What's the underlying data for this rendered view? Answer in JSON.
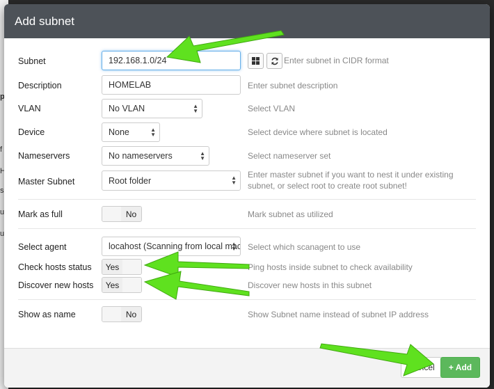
{
  "modal": {
    "title": "Add subnet"
  },
  "fields": {
    "subnet": {
      "label": "Subnet",
      "value": "192.168.1.0/24",
      "hint": "Enter subnet in CIDR format"
    },
    "description": {
      "label": "Description",
      "value": "HOMELAB",
      "hint": "Enter subnet description"
    },
    "vlan": {
      "label": "VLAN",
      "value": "No VLAN",
      "hint": "Select VLAN"
    },
    "device": {
      "label": "Device",
      "value": "None",
      "hint": "Select device where subnet is located"
    },
    "nameservers": {
      "label": "Nameservers",
      "value": "No nameservers",
      "hint": "Select nameserver set"
    },
    "master_subnet": {
      "label": "Master Subnet",
      "value": "Root folder",
      "hint": "Enter master subnet if you want to nest it under existing subnet, or select root to create root subnet!"
    },
    "mark_full": {
      "label": "Mark as full",
      "value": "No",
      "hint": "Mark subnet as utilized"
    },
    "agent": {
      "label": "Select agent",
      "value": "locahost (Scanning from local mac",
      "hint": "Select which scanagent to use"
    },
    "check_hosts": {
      "label": "Check hosts status",
      "value": "Yes",
      "hint": "Ping hosts inside subnet to check availability"
    },
    "discover_hosts": {
      "label": "Discover new hosts",
      "value": "Yes",
      "hint": "Discover new hosts in this subnet"
    },
    "show_name": {
      "label": "Show as name",
      "value": "No",
      "hint": "Show Subnet name instead of subnet IP address"
    }
  },
  "footer": {
    "cancel_label": "Cancel",
    "add_label": "+ Add"
  },
  "background": {
    "letters": [
      "p",
      "f",
      "H",
      "si",
      "us",
      "us"
    ]
  },
  "colors": {
    "header": "#4d5258",
    "add_button": "#5cb85c",
    "arrow": "#5fe11f"
  }
}
